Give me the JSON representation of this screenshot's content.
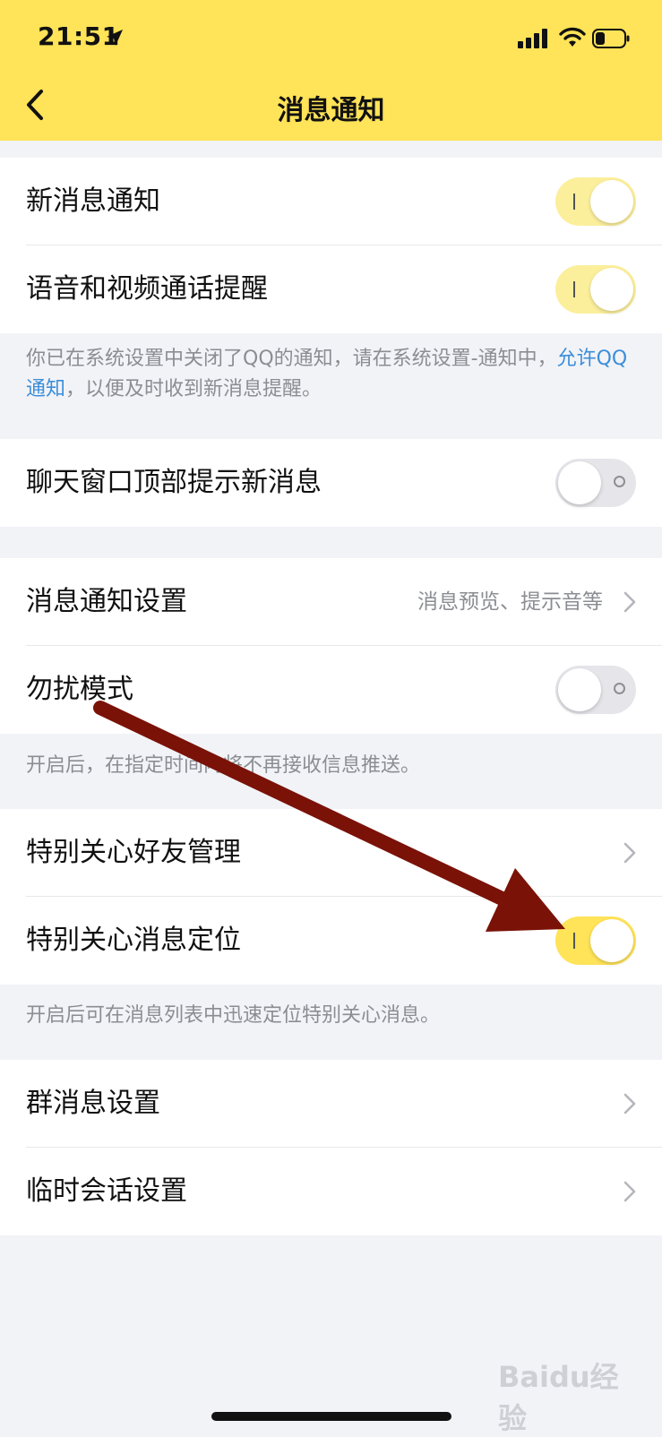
{
  "status_bar": {
    "time": "21:51"
  },
  "nav": {
    "title": "消息通知"
  },
  "group1": {
    "items": [
      {
        "label": "新消息通知",
        "toggle": true
      },
      {
        "label": "语音和视频通话提醒",
        "toggle": true
      }
    ]
  },
  "notice1": {
    "part1": "你已在系统设置中关闭了QQ的通知，请在系统设置-通知中，",
    "link": "允许QQ通知",
    "part2": "，以便及时收到新消息提醒。"
  },
  "group2": {
    "items": [
      {
        "label": "聊天窗口顶部提示新消息",
        "toggle": false
      }
    ]
  },
  "group3": {
    "items": [
      {
        "label": "消息通知设置",
        "value": "消息预览、提示音等"
      },
      {
        "label": "勿扰模式",
        "toggle": false
      }
    ]
  },
  "notice2": {
    "text": "开启后，在指定时间内将不再接收信息推送。"
  },
  "group4": {
    "items": [
      {
        "label": "特别关心好友管理"
      },
      {
        "label": "特别关心消息定位",
        "toggle": true
      }
    ]
  },
  "notice3": {
    "text": "开启后可在消息列表中迅速定位特别关心消息。"
  },
  "group5": {
    "items": [
      {
        "label": "群消息设置"
      },
      {
        "label": "临时会话设置"
      }
    ]
  },
  "colors": {
    "accent": "#ffe358",
    "link": "#3b8ed9",
    "arrow": "#7a1208"
  },
  "icons": [
    "location-arrow-icon",
    "signal-icon",
    "wifi-icon",
    "battery-icon",
    "back-chevron-icon",
    "chevron-right-icon"
  ],
  "watermark": {
    "text": "Baidu经验"
  }
}
